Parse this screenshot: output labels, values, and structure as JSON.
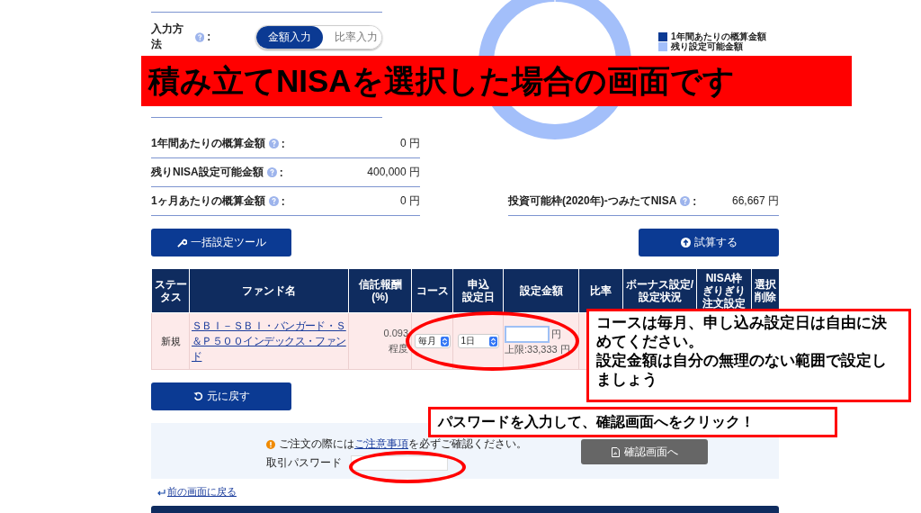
{
  "input_method": {
    "label": "入力方法",
    "separator": ":",
    "options": [
      {
        "label": "金額入力",
        "selected": true
      },
      {
        "label": "比率入力",
        "selected": false
      }
    ]
  },
  "legend": [
    {
      "label": "1年間あたりの概算金額",
      "color": "#0b3a93"
    },
    {
      "label": "残り設定可能金額",
      "color": "#a3bffa"
    }
  ],
  "summary": [
    {
      "label": "1年間あたりの概算金額",
      "separator": ":",
      "value": "0 円"
    },
    {
      "label": "残りNISA設定可能金額",
      "separator": ":",
      "value": "400,000 円"
    },
    {
      "label": "1ヶ月あたりの概算金額",
      "separator": ":",
      "value": "0 円"
    }
  ],
  "quota": {
    "label": "投資可能枠(2020年)-つみたてNISA",
    "separator": ":",
    "value": "66,667 円"
  },
  "buttons": {
    "bulk_tool": "一括設定ツール",
    "simulate": "試算する",
    "reset": "元に戻す"
  },
  "table": {
    "columns": [
      [
        "ステー",
        "タス"
      ],
      [
        "ファンド名"
      ],
      [
        "信託報酬",
        "(%)"
      ],
      [
        "コース"
      ],
      [
        "申込",
        "設定日"
      ],
      [
        "設定金額"
      ],
      [
        "比率"
      ],
      [
        "ボーナス設定/",
        "設定状況"
      ],
      [
        "NISA枠",
        "ぎりぎり",
        "注文設定"
      ],
      [
        "選択",
        "削除"
      ]
    ],
    "rows": [
      {
        "status": "新規",
        "fund": "ＳＢＩ－ＳＢＩ・バンガード・Ｓ＆Ｐ５００インデックス・ファンド",
        "fee": "0.093",
        "fee_note": "程度",
        "course": "毎月",
        "day": "1日",
        "amount_unit": "円",
        "limit": "上限:33,333 円"
      }
    ]
  },
  "order": {
    "notice_before": "ご注文の際には",
    "notice_link": "ご注意事項",
    "notice_after": "を必ずご確認ください。",
    "password_label": "取引パスワード",
    "confirm": "確認画面へ"
  },
  "back_link": "前の画面に戻る",
  "annotations": {
    "banner": "積み立てNISAを選択した場合の画面です",
    "callouts": [
      {
        "kind": "course",
        "lines": [
          "コースは毎月、申し込み設定日は自由に決めてください。",
          "設定金額は自分の無理のない範囲で設定しましょう"
        ]
      },
      {
        "kind": "password",
        "lines": [
          "パスワードを入力して、確認画面へをクリック！"
        ]
      }
    ]
  }
}
